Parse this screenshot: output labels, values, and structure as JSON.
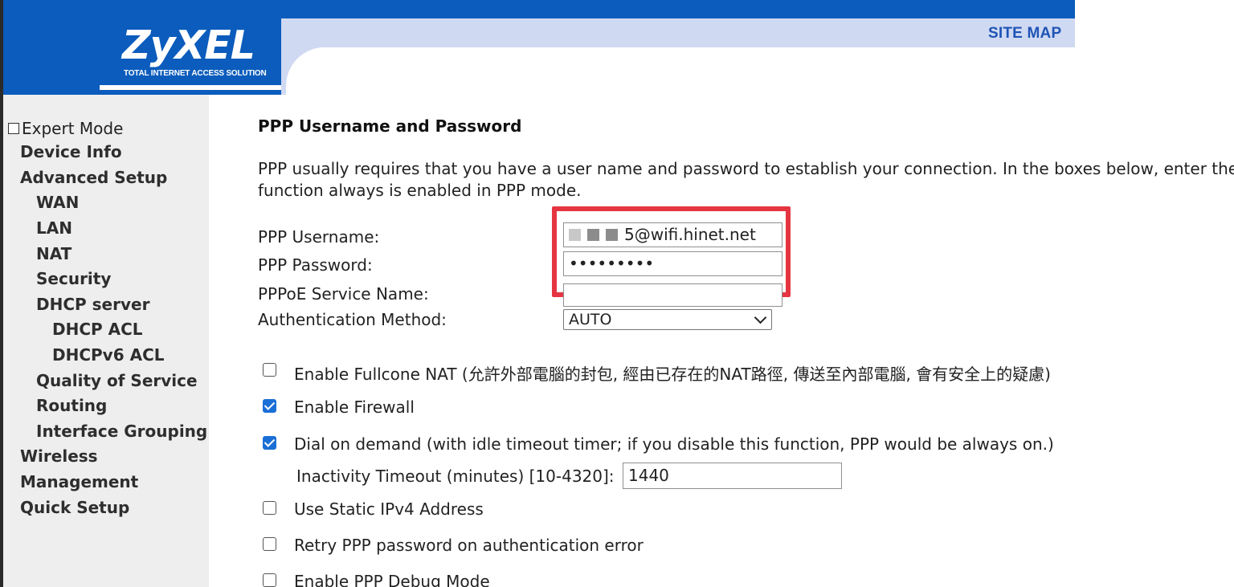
{
  "header": {
    "logo": "ZyXEL",
    "tagline": "TOTAL INTERNET ACCESS SOLUTION",
    "site_map": "SITE MAP",
    "colors": {
      "bar": "#0b5cbc",
      "band": "#cfd9f2"
    }
  },
  "sidebar": {
    "expert_mode": {
      "label": "Expert Mode",
      "checked": false
    },
    "items": {
      "device_info": "Device Info",
      "advanced_setup": "Advanced Setup",
      "wan": "WAN",
      "lan": "LAN",
      "nat": "NAT",
      "security": "Security",
      "dhcp_server": "DHCP server",
      "dhcp_acl": "DHCP ACL",
      "dhcpv6_acl": "DHCPv6 ACL",
      "qos": "Quality of Service",
      "routing": "Routing",
      "interface_grouping": "Interface Grouping",
      "wireless": "Wireless",
      "management": "Management",
      "quick_setup": "Quick Setup"
    }
  },
  "main": {
    "title": "PPP Username and Password",
    "description_line1": "PPP usually requires that you have a user name and password to establish your connection. In the boxes below, enter the u",
    "description_line2": "function always is enabled in PPP mode.",
    "fields": {
      "username_label": "PPP Username:",
      "username_value": "5@wifi.hinet.net",
      "password_label": "PPP Password:",
      "password_value": "•••••••••",
      "service_label": "PPPoE Service Name:",
      "service_value": "",
      "auth_label": "Authentication Method:",
      "auth_value": "AUTO"
    },
    "options": {
      "fullcone": {
        "label": "Enable Fullcone NAT (允許外部電腦的封包, 經由已存在的NAT路徑, 傳送至內部電腦, 會有安全上的疑慮)",
        "checked": false
      },
      "firewall": {
        "label": "Enable Firewall",
        "checked": true
      },
      "dial_on_demand": {
        "label": "Dial on demand (with idle timeout timer; if you disable this function, PPP would be always on.)",
        "checked": true
      },
      "inactivity_label": "Inactivity Timeout (minutes) [10-4320]:",
      "inactivity_value": "1440",
      "static_ipv4": {
        "label": "Use Static IPv4 Address",
        "checked": false
      },
      "retry_ppp": {
        "label": "Retry PPP password on authentication error",
        "checked": false
      },
      "debug_mode": {
        "label": "Enable PPP Debug Mode",
        "checked": false
      }
    },
    "highlight_color": "#e53541"
  }
}
